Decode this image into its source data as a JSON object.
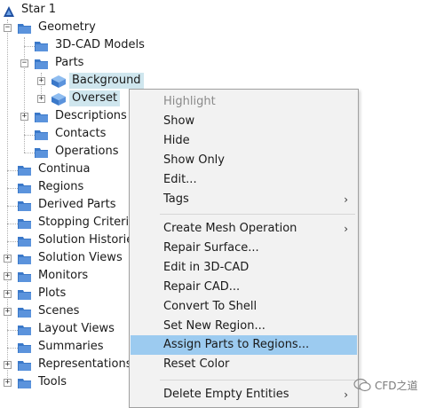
{
  "tree": {
    "root": "Star 1",
    "geometry": "Geometry",
    "geometry_children": [
      "3D-CAD Models",
      "Parts",
      "Descriptions",
      "Contacts",
      "Operations"
    ],
    "parts_children": [
      "Background",
      "Overset"
    ],
    "top_level": [
      "Continua",
      "Regions",
      "Derived Parts",
      "Stopping Criteria",
      "Solution Histories",
      "Solution Views",
      "Monitors",
      "Plots",
      "Scenes",
      "Layout Views",
      "Summaries",
      "Representations",
      "Tools"
    ]
  },
  "menu": {
    "items": [
      "Highlight",
      "Show",
      "Hide",
      "Show Only",
      "Edit...",
      "Tags",
      "Create Mesh Operation",
      "Repair Surface...",
      "Edit in 3D-CAD",
      "Repair CAD...",
      "Convert To Shell",
      "Set New Region...",
      "Assign Parts to Regions...",
      "Reset Color",
      "Delete Empty Entities"
    ],
    "highlight_color": "#9ccbf0"
  },
  "watermark": "CFD之道",
  "colors": {
    "folder": "#3a78c9",
    "selection": "#cfe6ee"
  }
}
